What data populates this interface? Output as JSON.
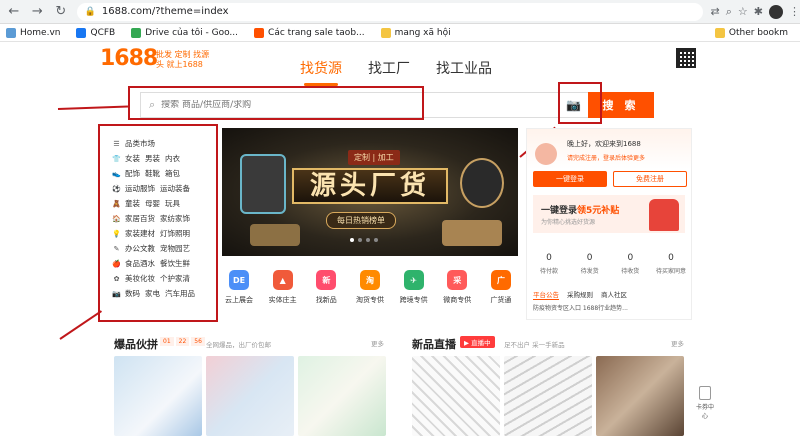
{
  "browser": {
    "back": "←",
    "forward": "→",
    "reload": "↻",
    "url": "1688.com/?theme=index",
    "bookmarks": [
      "Home.vn",
      "QCFB",
      "Drive của tôi - Goo...",
      "Các trang sale taob...",
      "mang xã hội"
    ],
    "other_bookmarks": "Other bookm"
  },
  "header": {
    "logo": "1688",
    "slogan": "批发 定制 找源头 就上1688",
    "tabs": [
      "找货源",
      "找工厂",
      "找工业品"
    ]
  },
  "search": {
    "placeholder": "搜索 商品/供应商/求购",
    "button": "搜 索"
  },
  "categories": [
    {
      "icon": "☰",
      "items": [
        "品类市场"
      ]
    },
    {
      "icon": "👕",
      "items": [
        "女装",
        "男装",
        "内衣"
      ]
    },
    {
      "icon": "👟",
      "items": [
        "配饰",
        "鞋靴",
        "箱包"
      ]
    },
    {
      "icon": "⚽",
      "items": [
        "运动服饰",
        "运动装备"
      ]
    },
    {
      "icon": "🧸",
      "items": [
        "童装",
        "母婴",
        "玩具"
      ]
    },
    {
      "icon": "🏠",
      "items": [
        "家居百货",
        "家纺家饰"
      ]
    },
    {
      "icon": "💡",
      "items": [
        "家装建材",
        "灯饰照明"
      ]
    },
    {
      "icon": "✎",
      "items": [
        "办公文教",
        "宠物园艺"
      ]
    },
    {
      "icon": "🍎",
      "items": [
        "食品酒水",
        "餐饮生鲜"
      ]
    },
    {
      "icon": "✿",
      "items": [
        "美妆化妆",
        "个护家清"
      ]
    },
    {
      "icon": "📷",
      "items": [
        "数码",
        "家电",
        "汽车用品"
      ]
    }
  ],
  "banner": {
    "tag": "定制 | 加工",
    "headline": "源头厂货",
    "sub": "每日热销榜单"
  },
  "services": [
    {
      "abbr": "DE",
      "label": "云上展会",
      "color": "#4c8ff7"
    },
    {
      "abbr": "▲",
      "label": "实体庄主",
      "color": "#f05a3a"
    },
    {
      "abbr": "新",
      "label": "找新品",
      "color": "#ff4d6d"
    },
    {
      "abbr": "淘",
      "label": "淘货专供",
      "color": "#ff8a00"
    },
    {
      "abbr": "✈",
      "label": "跨境专供",
      "color": "#2fb36c"
    },
    {
      "abbr": "采",
      "label": "微商专供",
      "color": "#ff5a5a"
    },
    {
      "abbr": "广",
      "label": "广货通",
      "color": "#ff6a00"
    }
  ],
  "login": {
    "greeting": "晚上好，欢迎来到1688",
    "warning": "请完成注册，登录后体验更多",
    "login_btn": "一键登录",
    "register_btn": "免费注册",
    "promo_main": "一键登录",
    "promo_highlight": "领5元补贴",
    "promo_sub": "为你精心挑选好货源",
    "stats": [
      {
        "num": "0",
        "label": "待付款"
      },
      {
        "num": "0",
        "label": "待发货"
      },
      {
        "num": "0",
        "label": "待收货"
      },
      {
        "num": "0",
        "label": "待买家同意"
      }
    ],
    "tabs": [
      "平台公告",
      "采购规则",
      "商人社区"
    ],
    "news": "防疫物资专区入口  1688行业趋势..."
  },
  "sections": {
    "hot": {
      "title": "爆品伙拼",
      "timer": [
        "01",
        "22",
        "56"
      ],
      "sub": "全网爆品，出厂价包邮",
      "more": "更多"
    },
    "live": {
      "title": "新品直播",
      "tag": "▶ 直播中",
      "sub": "足不出户 采一手新品",
      "more": "更多"
    }
  },
  "side_tool": "卡券中心"
}
